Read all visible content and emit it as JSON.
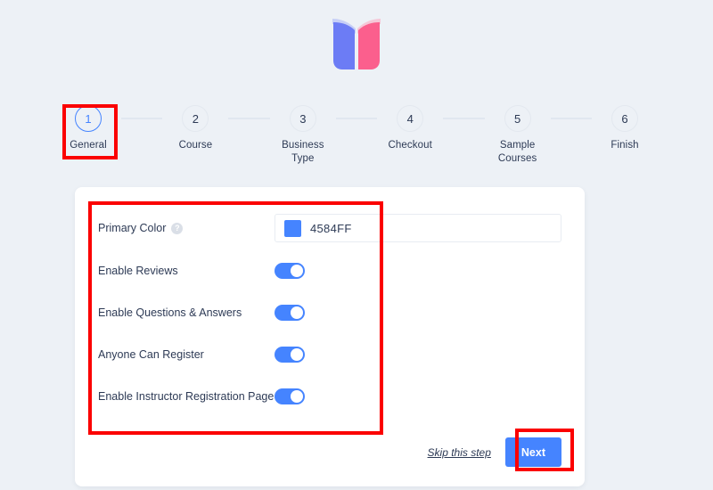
{
  "brand": {
    "logo_icon": "open-book-icon",
    "logo_left_color": "#6c7cf5",
    "logo_right_color": "#fb5f8d",
    "accent_color": "#4584FF",
    "page_background": "#edf1f6"
  },
  "stepper": {
    "current_step": 1,
    "steps": [
      {
        "number": "1",
        "label": "General"
      },
      {
        "number": "2",
        "label": "Course"
      },
      {
        "number": "3",
        "label": "Business Type"
      },
      {
        "number": "4",
        "label": "Checkout"
      },
      {
        "number": "5",
        "label": "Sample Courses"
      },
      {
        "number": "6",
        "label": "Finish"
      }
    ]
  },
  "form": {
    "color_field": {
      "label": "Primary Color",
      "help_icon": "question-mark-icon",
      "help_glyph": "?",
      "value": "4584FF",
      "swatch_color": "#4584FF"
    },
    "toggles": [
      {
        "label": "Enable Reviews",
        "state": "on"
      },
      {
        "label": "Enable Questions & Answers",
        "state": "on"
      },
      {
        "label": "Anyone Can Register",
        "state": "on"
      },
      {
        "label": "Enable Instructor Registration Page",
        "state": "on"
      }
    ]
  },
  "footer": {
    "skip_label": "Skip this step",
    "next_label": "Next"
  },
  "annotations": {
    "color": "#fb0000",
    "boxes": [
      {
        "name": "step-general-highlight"
      },
      {
        "name": "settings-form-highlight"
      },
      {
        "name": "next-button-highlight"
      }
    ]
  }
}
